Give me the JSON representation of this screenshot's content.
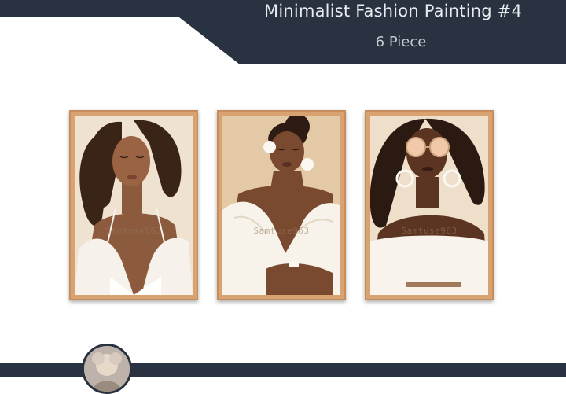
{
  "header": {
    "title": "Minimalist Fashion Painting #4",
    "subtitle": "6 Piece",
    "band_color": "#283240"
  },
  "gallery": {
    "paintings": [
      {
        "watermark": "Samtuse963",
        "subject": "woman-eyes-closed-curly-hair-white-robe"
      },
      {
        "watermark": "Samtuse963",
        "subject": "woman-bun-pearl-earrings-white-off-shoulder"
      },
      {
        "watermark": "Samtuse963",
        "subject": "woman-sunglasses-hoop-earrings-white-top"
      }
    ],
    "frame_color": "#d8a271"
  },
  "footer": {
    "avatar": "profile-avatar"
  }
}
